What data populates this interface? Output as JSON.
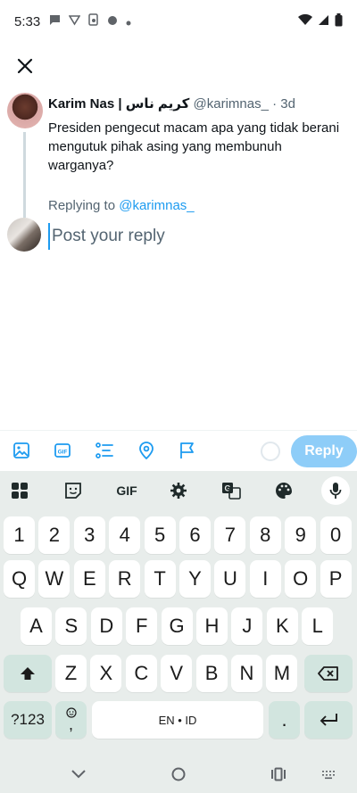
{
  "status_bar": {
    "time": "5:33"
  },
  "tweet": {
    "name": "Karim Nas | كريم ناس",
    "handle": "@karimnas_",
    "age": "3d",
    "text": "Presiden pengecut macam apa yang tidak berani mengutuk pihak asing yang membunuh warganya?"
  },
  "replying": {
    "prefix": "Replying to",
    "handle": "@karimnas_"
  },
  "composer": {
    "placeholder": "Post your reply",
    "reply_label": "Reply"
  },
  "keyboard": {
    "row_numbers": [
      "1",
      "2",
      "3",
      "4",
      "5",
      "6",
      "7",
      "8",
      "9",
      "0"
    ],
    "row_1": [
      "Q",
      "W",
      "E",
      "R",
      "T",
      "Y",
      "U",
      "I",
      "O",
      "P"
    ],
    "row_2": [
      "A",
      "S",
      "D",
      "F",
      "G",
      "H",
      "J",
      "K",
      "L"
    ],
    "row_3": [
      "Z",
      "X",
      "C",
      "V",
      "B",
      "N",
      "M"
    ],
    "symbols_label": "?123",
    "comma": ",",
    "space_label": "EN • ID",
    "period": ".",
    "gif_label": "GIF"
  },
  "colors": {
    "accent": "#1d9bf0",
    "reply_button_disabled": "#8ecdf8",
    "keyboard_bg": "#e8edeb",
    "key_dark": "#d2e5df"
  }
}
